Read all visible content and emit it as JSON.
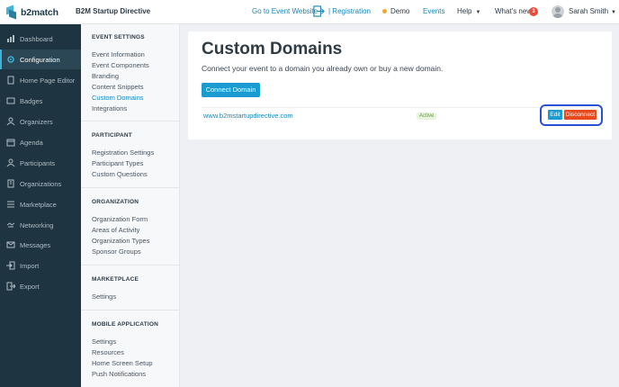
{
  "header": {
    "logo_text": "b2match",
    "event_name": "B2M Startup Directive",
    "go_to_event_website": "Go to Event Website",
    "registration": "| Registration",
    "demo": "Demo",
    "events": "Events",
    "help": "Help",
    "whats_new": "What's new",
    "whats_new_count": "3",
    "user_name": "Sarah Smith",
    "colors": {
      "accent": "#1a86b8",
      "demo_dot": "#f5a623",
      "badge": "#e84a3c"
    }
  },
  "sidebar": {
    "items": [
      {
        "label": "Dashboard",
        "icon": "dashboard-icon"
      },
      {
        "label": "Configuration",
        "icon": "gear-icon",
        "active": true
      },
      {
        "label": "Home Page Editor",
        "icon": "document-icon"
      },
      {
        "label": "Badges",
        "icon": "badge-icon"
      },
      {
        "label": "Organizers",
        "icon": "people-icon"
      },
      {
        "label": "Agenda",
        "icon": "calendar-icon"
      },
      {
        "label": "Participants",
        "icon": "participants-icon"
      },
      {
        "label": "Organizations",
        "icon": "building-icon"
      },
      {
        "label": "Marketplace",
        "icon": "list-icon"
      },
      {
        "label": "Networking",
        "icon": "handshake-icon"
      },
      {
        "label": "Messages",
        "icon": "envelope-icon"
      },
      {
        "label": "Import",
        "icon": "import-icon"
      },
      {
        "label": "Export",
        "icon": "export-icon"
      }
    ]
  },
  "subnav": {
    "event_settings": {
      "title": "EVENT SETTINGS",
      "links": [
        "Event Information",
        "Event Components",
        "Branding",
        "Content Snippets",
        "Custom Domains",
        "Integrations"
      ]
    },
    "participant": {
      "title": "PARTICIPANT",
      "links": [
        "Registration Settings",
        "Participant Types",
        "Custom Questions"
      ]
    },
    "organization": {
      "title": "ORGANIZATION",
      "links": [
        "Organization Form",
        "Areas of Activity",
        "Organization Types",
        "Sponsor Groups"
      ]
    },
    "marketplace": {
      "title": "MARKETPLACE",
      "links": [
        "Settings"
      ]
    },
    "mobile_application": {
      "title": "MOBILE APPLICATION",
      "links": [
        "Settings",
        "Resources",
        "Home Screen Setup",
        "Push Notifications"
      ]
    }
  },
  "main": {
    "title": "Custom Domains",
    "subtitle": "Connect your event to a domain you already own or buy a new domain.",
    "connect_button": "Connect Domain",
    "domain": {
      "url": "www.b2mstartupdirective.com",
      "status": "Active",
      "edit_label": "Edit",
      "disconnect_label": "Disconnect"
    }
  }
}
